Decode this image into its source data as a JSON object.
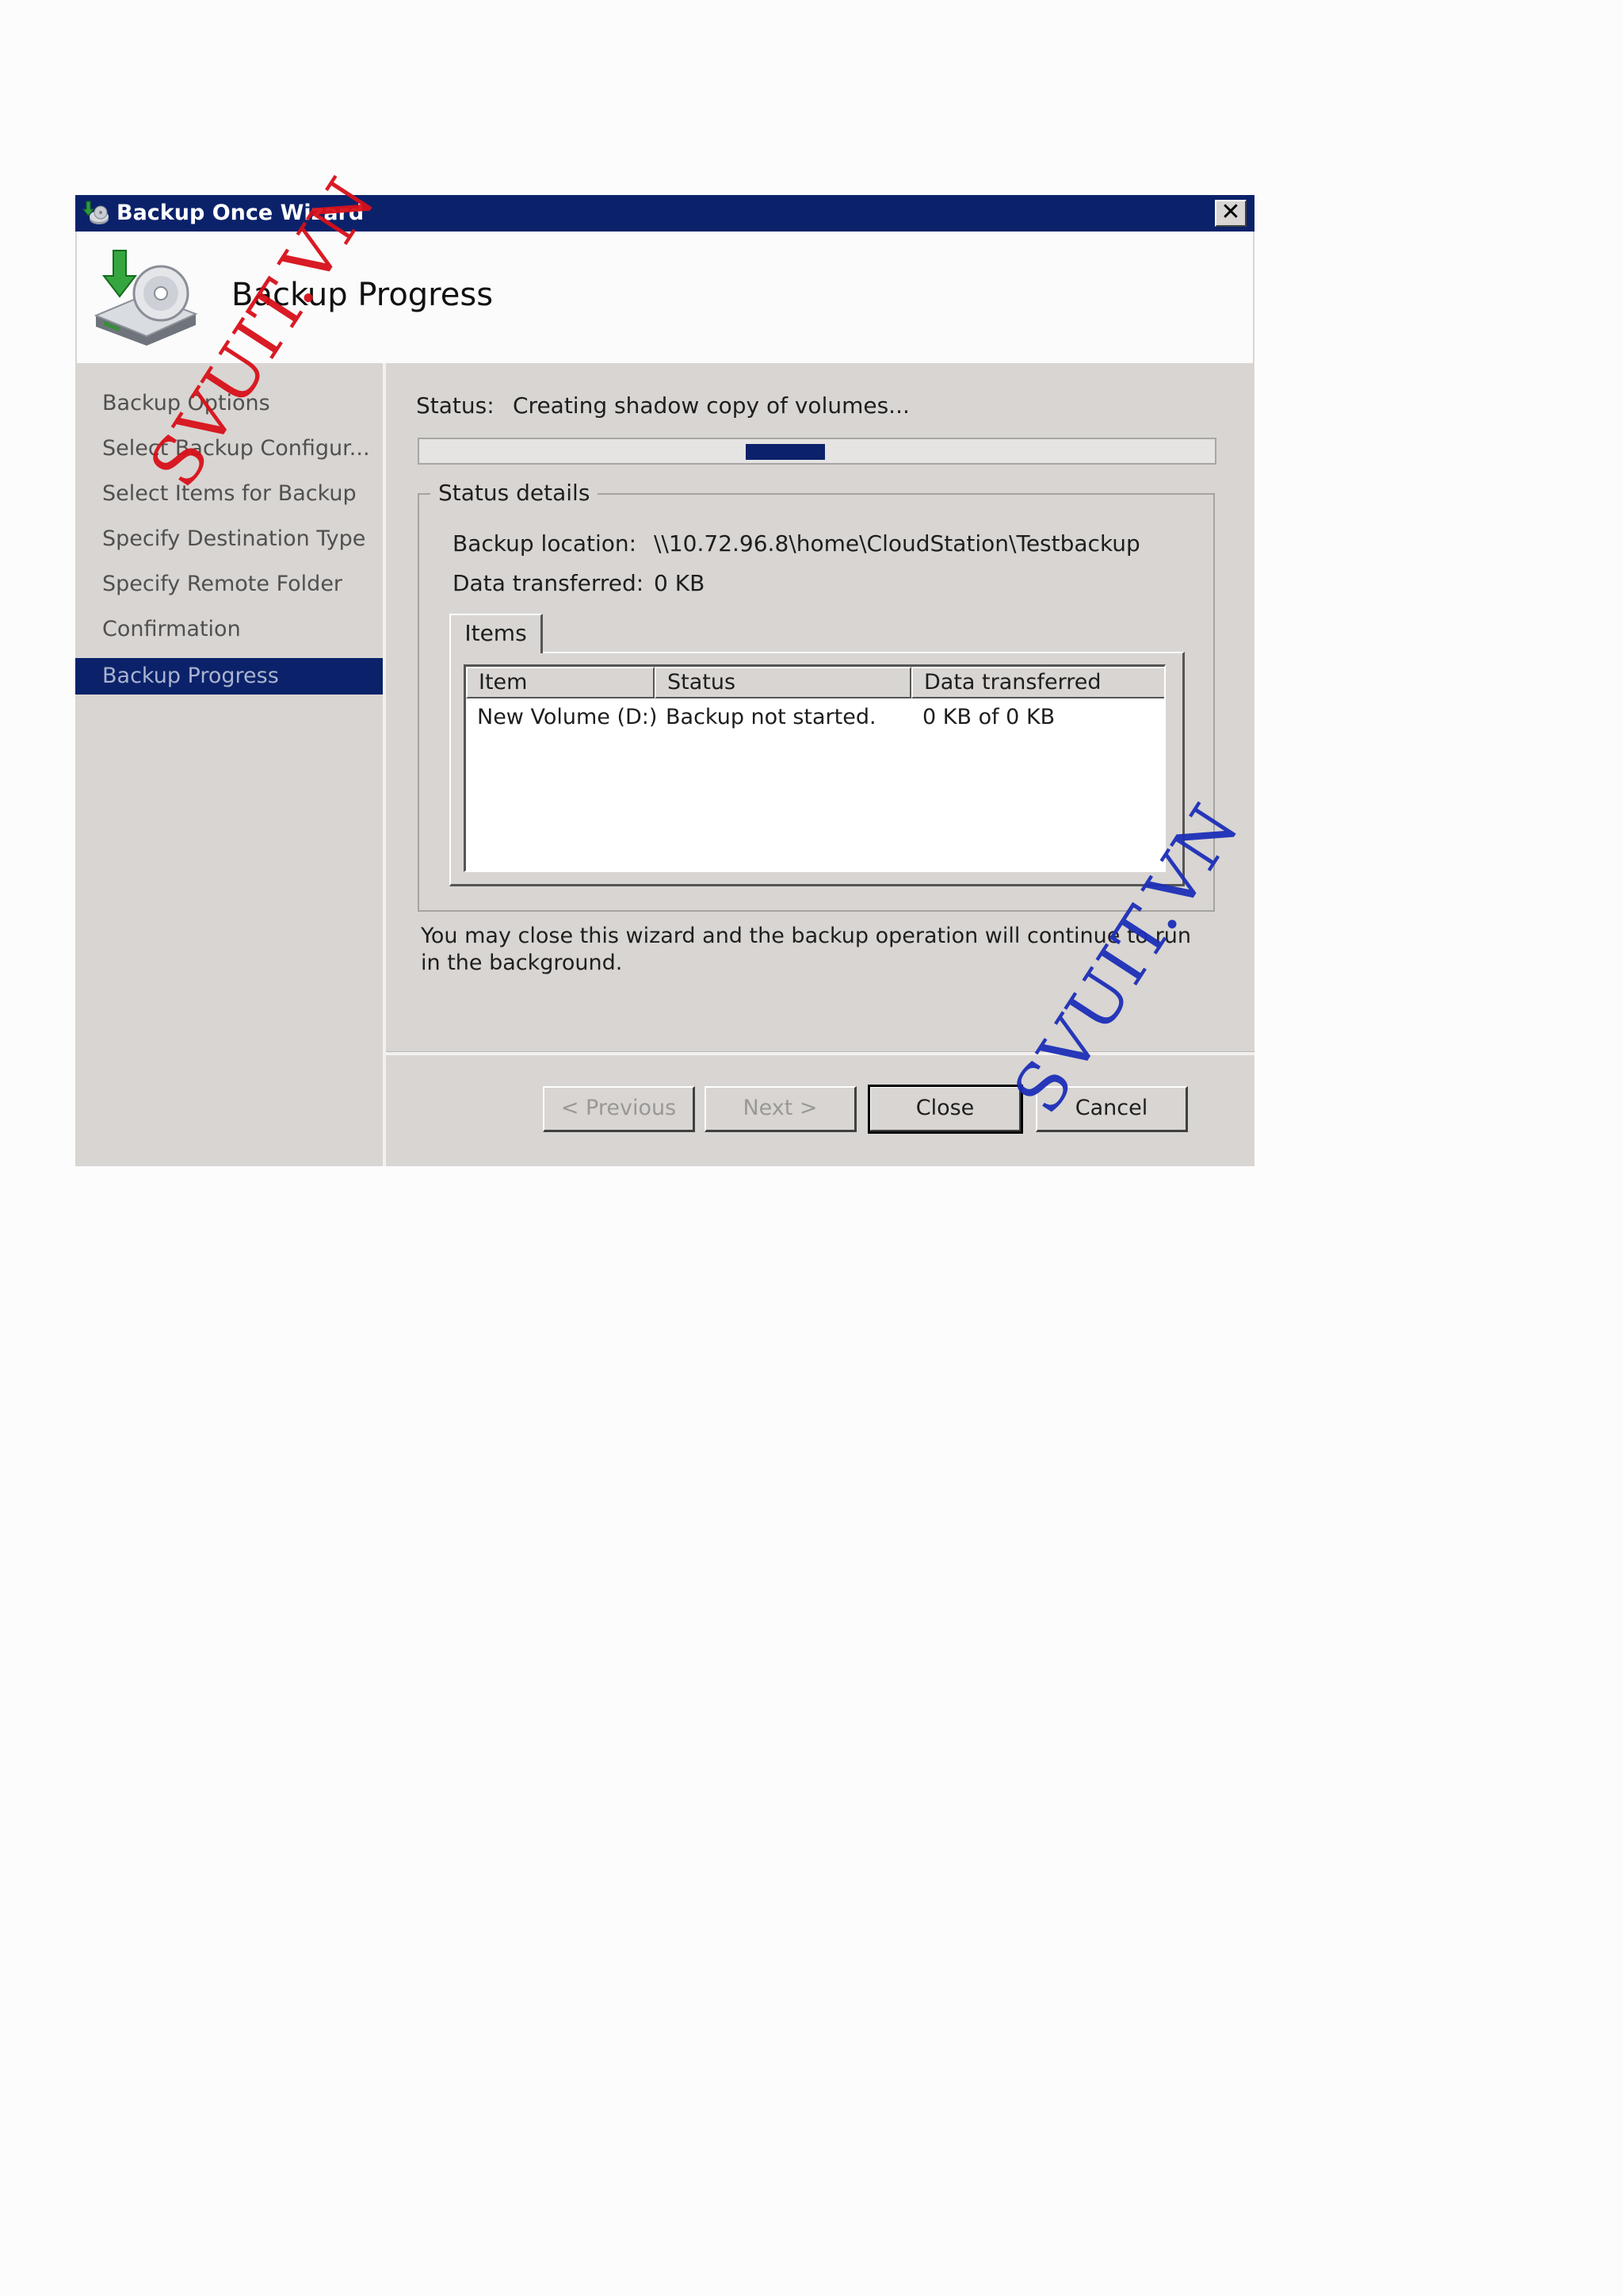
{
  "window": {
    "title": "Backup Once Wizard",
    "close_glyph": "✕"
  },
  "header": {
    "title": "Backup Progress"
  },
  "nav": {
    "items": [
      {
        "label": "Backup Options"
      },
      {
        "label": "Select Backup Configur..."
      },
      {
        "label": "Select Items for Backup"
      },
      {
        "label": "Specify Destination Type"
      },
      {
        "label": "Specify Remote Folder"
      },
      {
        "label": "Confirmation"
      },
      {
        "label": "Backup Progress"
      }
    ],
    "active_index": 6
  },
  "status": {
    "label": "Status:",
    "value": "Creating shadow copy of volumes...",
    "progress_marquee_start": 0.41,
    "progress_marquee_end": 0.51
  },
  "details": {
    "legend": "Status details",
    "backup_location_label": "Backup location:",
    "backup_location_value": "\\\\10.72.96.8\\home\\CloudStation\\Testbackup",
    "data_transferred_label": "Data transferred:",
    "data_transferred_value": "0 KB",
    "tab_label": "Items",
    "columns": [
      "Item",
      "Status",
      "Data transferred"
    ],
    "rows": [
      [
        "New Volume (D:)",
        "Backup not started.",
        "0 KB of 0 KB"
      ]
    ]
  },
  "note": "You may close this wizard and the backup operation will continue to run in the background.",
  "buttons": {
    "previous": "< Previous",
    "next": "Next >",
    "close": "Close",
    "cancel": "Cancel"
  },
  "watermarks": [
    "SVUIT.VN",
    "SVUIT.VN"
  ],
  "colors": {
    "title_bar": "#0b226a",
    "watermark_red": "#d8101a",
    "watermark_blue": "#1d2fb8"
  },
  "icons": {
    "title": "backup-wizard-icon",
    "header": "backup-disk-icon",
    "close": "close-icon"
  }
}
